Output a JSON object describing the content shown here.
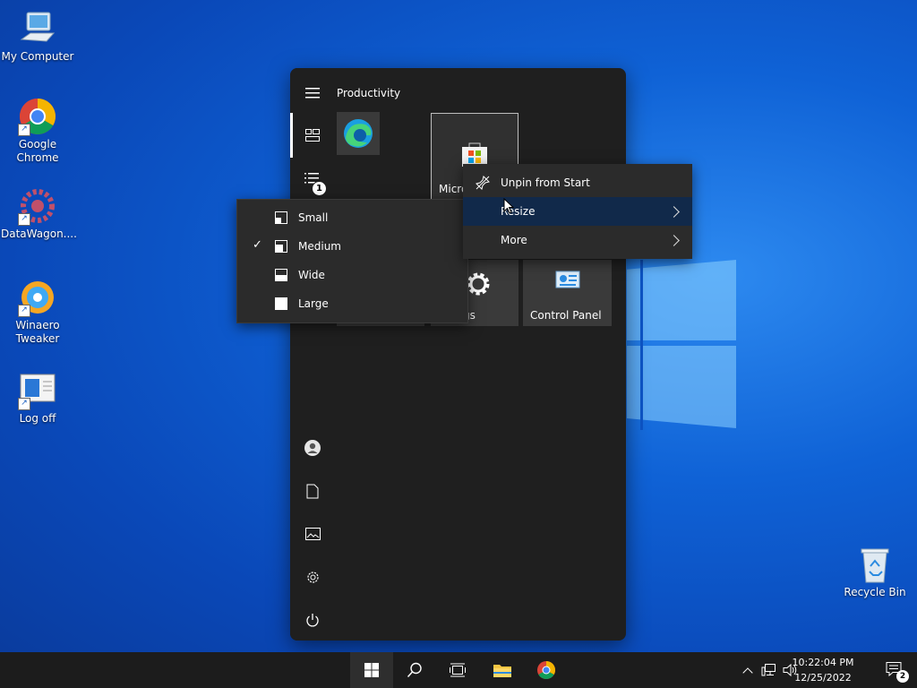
{
  "desktop": {
    "icons": [
      {
        "label": "My Computer"
      },
      {
        "label": "Google Chrome"
      },
      {
        "label": "DataWagon...."
      },
      {
        "label": "Winaero Tweaker"
      },
      {
        "label": "Log off"
      },
      {
        "label": "Recycle Bin"
      }
    ]
  },
  "start_menu": {
    "group_title": "Productivity",
    "nav_badge": "1",
    "tiles": {
      "store_label": "Micro",
      "settings_label": "gs",
      "control_panel_label": "Control Panel"
    }
  },
  "context_menu": {
    "items": [
      {
        "label": "Unpin from Start"
      },
      {
        "label": "Resize"
      },
      {
        "label": "More"
      }
    ]
  },
  "resize_submenu": {
    "items": [
      {
        "label": "Small",
        "checked": false
      },
      {
        "label": "Medium",
        "checked": true
      },
      {
        "label": "Wide",
        "checked": false
      },
      {
        "label": "Large",
        "checked": false
      }
    ]
  },
  "taskbar": {
    "clock_time": "10:22:04 PM",
    "clock_date": "12/25/2022",
    "notification_count": "2"
  },
  "colors": {
    "desktop_blue": "#0f62d6",
    "menu_bg": "#1f1f1f",
    "highlight": "#11294a",
    "taskbar": "#1c1c1c"
  }
}
